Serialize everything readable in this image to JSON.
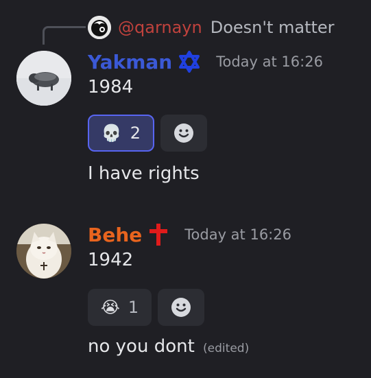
{
  "reply": {
    "author": "@qarnayn",
    "text": "Doesn't matter"
  },
  "messages": [
    {
      "username": "Yakman",
      "username_color": "#3b59d6",
      "badge_icon": "star-of-david-icon",
      "timestamp": "Today at 16:26",
      "lines": [
        "1984"
      ],
      "reaction": {
        "emoji": "💀",
        "emoji_name": "skull",
        "count": "2",
        "active": true
      },
      "followup": "I have rights"
    },
    {
      "username": "Behe",
      "username_color": "#e8641e",
      "badge_icon": "cross-icon",
      "timestamp": "Today at 16:26",
      "lines": [
        "1942"
      ],
      "reaction": {
        "emoji": "😭",
        "emoji_name": "loudly-crying",
        "count": "1",
        "active": false
      },
      "followup": "no you dont",
      "edited_label": "(edited)"
    }
  ],
  "colors": {
    "background": "#1f1f24",
    "reaction_bg": "#2c2d33",
    "reaction_active_bg": "#353a66",
    "reaction_active_border": "#5865f2",
    "reply_author": "#c0423d",
    "badge_cross": "#e01b1b",
    "badge_star": "#2040e0"
  }
}
